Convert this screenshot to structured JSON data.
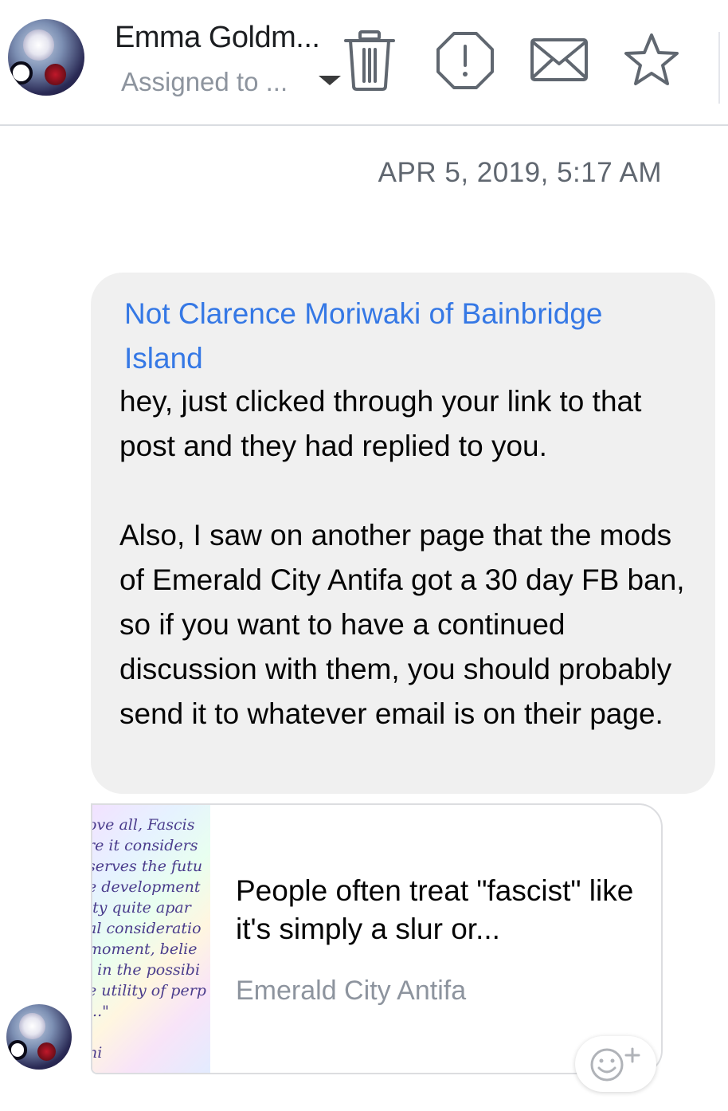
{
  "header": {
    "contact_name": "Emma Goldm...",
    "assigned_label": "Assigned to ...",
    "icons": [
      "trash-icon",
      "alert-icon",
      "mail-icon",
      "star-icon"
    ]
  },
  "thread": {
    "timestamp": "APR 5, 2019, 5:17 AM",
    "message": {
      "sender": "Not Clarence Moriwaki of Bainbridge Island",
      "body": "hey, just clicked through your link to that post and they had replied to you.\n\nAlso, I saw on another page that the mods of Emerald City Antifa got a 30 day FB ban, so if you want to have a continued discussion with them, you should probably send it to whatever email is on their page."
    },
    "link_preview": {
      "title": "People often treat \"fascist\" like it's simply a slur or...",
      "source": "Emerald City Antifa",
      "thumbnail_lines": [
        "ove all, Fascis",
        "re it considers",
        "serves the futu",
        "e development",
        "ity quite apar",
        "al consideratio",
        "moment, belie",
        "i in the possibi",
        "e utility of perp",
        " ...\"",
        "",
        "ni"
      ]
    }
  },
  "colors": {
    "link_blue": "#3578e5",
    "bubble_gray": "#f0f0f0",
    "muted_text": "#8d949e"
  }
}
